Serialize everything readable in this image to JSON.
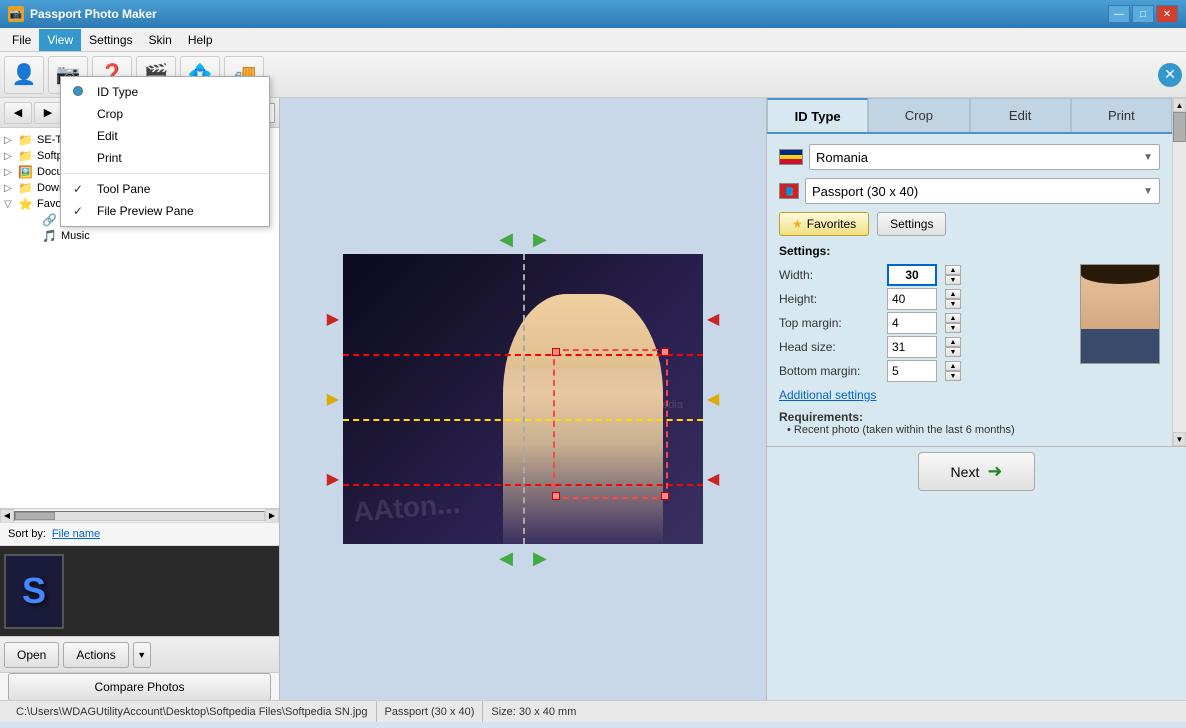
{
  "titleBar": {
    "title": "Passport Photo Maker",
    "icon": "📷",
    "minLabel": "—",
    "maxLabel": "□",
    "closeLabel": "✕"
  },
  "menuBar": {
    "items": [
      "File",
      "View",
      "Settings",
      "Skin",
      "Help"
    ]
  },
  "toolbar": {
    "buttons": [
      {
        "icon": "👤",
        "name": "person-icon"
      },
      {
        "icon": "📷",
        "name": "camera-icon"
      },
      {
        "icon": "❓",
        "name": "help-icon"
      },
      {
        "icon": "🎬",
        "name": "video-icon"
      },
      {
        "icon": "🔵",
        "name": "blue-icon"
      },
      {
        "icon": "🚛",
        "name": "truck-icon"
      }
    ],
    "closeIcon": "✕"
  },
  "viewMenu": {
    "items": [
      {
        "label": "ID Type",
        "type": "radio",
        "checked": true
      },
      {
        "label": "Crop",
        "type": "normal"
      },
      {
        "label": "Edit",
        "type": "normal"
      },
      {
        "label": "Print",
        "type": "normal"
      },
      {
        "label": "Tool Pane",
        "type": "check",
        "checked": true
      },
      {
        "label": "File Preview Pane",
        "type": "check",
        "checked": true
      }
    ]
  },
  "leftPanel": {
    "treeItems": [
      {
        "indent": 1,
        "label": "SE-Tr",
        "type": "folder",
        "hasToggle": true
      },
      {
        "indent": 1,
        "label": "Softpc",
        "type": "folder",
        "hasToggle": true
      },
      {
        "indent": 1,
        "label": "Documer",
        "type": "folder-image",
        "hasToggle": true
      },
      {
        "indent": 1,
        "label": "Downloac",
        "type": "folder",
        "hasToggle": true
      },
      {
        "indent": 1,
        "label": "Favorites",
        "type": "star",
        "hasToggle": true
      },
      {
        "indent": 2,
        "label": "Links",
        "type": "link"
      },
      {
        "indent": 2,
        "label": "Music",
        "type": "music"
      }
    ],
    "sortLabel": "Sort by:",
    "sortValue": "File name",
    "openLabel": "Open",
    "actionsLabel": "Actions",
    "compareLabel": "Compare Photos"
  },
  "rightPanel": {
    "tabs": [
      "ID Type",
      "Crop",
      "Edit",
      "Print"
    ],
    "activeTab": "ID Type",
    "country": "Romania",
    "document": "Passport (30 x 40)",
    "favoritesLabel": "Favorites",
    "settingsLabel": "Settings",
    "settings": {
      "label": "Settings:",
      "widthLabel": "Width:",
      "widthValue": "30",
      "heightLabel": "Height:",
      "heightValue": "40",
      "topMarginLabel": "Top margin:",
      "topMarginValue": "4",
      "headSizeLabel": "Head size:",
      "headSizeValue": "31",
      "bottomMarginLabel": "Bottom margin:",
      "bottomMarginValue": "5"
    },
    "additionalSettings": "Additional settings",
    "requirements": {
      "label": "Requirements:",
      "items": [
        "Recent photo (taken within the last 6 months)"
      ]
    },
    "nextLabel": "Next"
  },
  "statusBar": {
    "path": "C:\\Users\\WDAGUtilityAccount\\Desktop\\Softpedia Files\\Softpedia SN.jpg",
    "docType": "Passport (30 x 40)",
    "size": "Size: 30 x 40 mm"
  }
}
